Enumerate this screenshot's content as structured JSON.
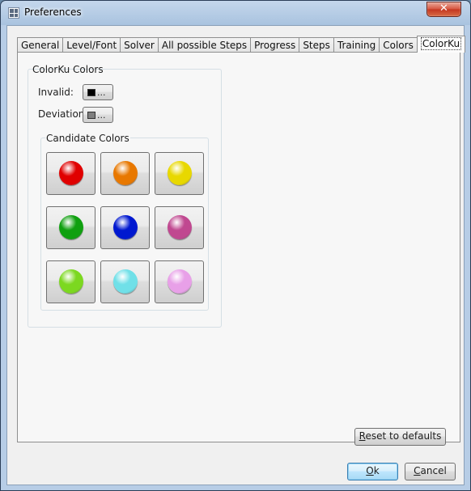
{
  "window": {
    "title": "Preferences",
    "close_label": "✕"
  },
  "tabs": [
    {
      "label": "General",
      "active": false
    },
    {
      "label": "Level/Font",
      "active": false
    },
    {
      "label": "Solver",
      "active": false
    },
    {
      "label": "All possible Steps",
      "active": false
    },
    {
      "label": "Progress",
      "active": false
    },
    {
      "label": "Steps",
      "active": false
    },
    {
      "label": "Training",
      "active": false
    },
    {
      "label": "Colors",
      "active": false
    },
    {
      "label": "ColorKu",
      "active": true
    }
  ],
  "colorku": {
    "group_title": "ColorKu Colors",
    "invalid": {
      "label": "Invalid:",
      "button_text": "...",
      "color": "#000000"
    },
    "deviation": {
      "label": "Deviation:",
      "button_text": "...",
      "color": "#7f7f7f"
    },
    "candidates_title": "Candidate Colors",
    "candidates": [
      {
        "name": "red",
        "color": "#e00000"
      },
      {
        "name": "orange",
        "color": "#e87800"
      },
      {
        "name": "yellow",
        "color": "#e8d800"
      },
      {
        "name": "green",
        "color": "#10a010"
      },
      {
        "name": "blue",
        "color": "#0018d0"
      },
      {
        "name": "magenta",
        "color": "#c04890"
      },
      {
        "name": "light-green",
        "color": "#7cd820"
      },
      {
        "name": "cyan",
        "color": "#70e0e8"
      },
      {
        "name": "pink",
        "color": "#e8a0e8"
      }
    ]
  },
  "buttons": {
    "reset_first": "R",
    "reset_rest": "eset to defaults",
    "ok_first": "O",
    "ok_rest": "k",
    "cancel_first": "C",
    "cancel_rest": "ancel"
  }
}
